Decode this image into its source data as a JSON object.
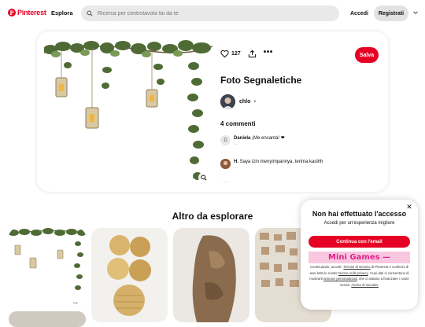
{
  "header": {
    "logo_text": "Pinterest",
    "explore_label": "Esplora",
    "search_placeholder": "Ricerca per centrotavola fai da te",
    "login_label": "Accedi",
    "signup_label": "Registrati"
  },
  "pin": {
    "like_count": "127",
    "save_label": "Salva",
    "title": "Foto Segnaletiche",
    "author_name": "chlo",
    "comments_heading": "4 commenti",
    "comments": [
      {
        "initial": "D",
        "user": "Daniela",
        "text": "¡Me encanta! ❤",
        "meta": "..."
      },
      {
        "initial": "",
        "user": "H.",
        "text": "Saya izin menyimpannya, terima kasihh",
        "meta": "..."
      }
    ],
    "more_comments": "..."
  },
  "explore": {
    "heading": "Altro da esplorare",
    "first_tile_more": "..."
  },
  "modal": {
    "close_icon": "close-icon",
    "title": "Non hai effettuato l'accesso",
    "subtitle": "Accedi per un'esperienza migliore",
    "email_button": "Continua con l'email",
    "ad_text": "Mini Games —",
    "legal_1": "Continuando, accetti i ",
    "legal_terms": "Termini di servizio",
    "legal_2": " di Pinterest e confermi di aver letto le nostre ",
    "legal_privacy": "Norme sulla privacy",
    "legal_3": ". I tuoi dati ci consentono di mostrarti ",
    "legal_ads": "annunci personalizzati",
    "legal_4": ", che ci aiutano a finanziare i nostri servizi. ",
    "legal_cookies": "Avviso di raccolta.",
    "colors": {
      "brand": "#e60023",
      "ad_bg": "#f9c7df",
      "ad_text": "#e0218a"
    }
  }
}
